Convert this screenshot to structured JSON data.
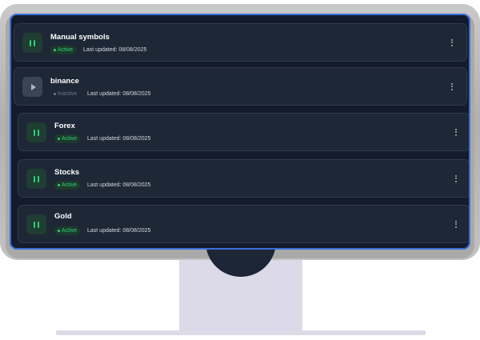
{
  "streams": [
    {
      "name": "Manual symbols",
      "status": "Active",
      "state": "active",
      "updated": "Last updated: 08/08/2025",
      "action_icon": "pause-icon",
      "menu_icon": "more-vertical-icon"
    },
    {
      "name": "binance",
      "status": "Inactive",
      "state": "inactive",
      "updated": "Last updated: 08/08/2025",
      "action_icon": "play-icon",
      "menu_icon": "more-vertical-icon"
    },
    {
      "name": "Forex",
      "status": "Active",
      "state": "active",
      "updated": "Last updated: 08/08/2025",
      "action_icon": "pause-icon",
      "menu_icon": "more-vertical-icon"
    },
    {
      "name": "Stocks",
      "status": "Active",
      "state": "active",
      "updated": "Last updated: 08/08/2025",
      "action_icon": "pause-icon",
      "menu_icon": "more-vertical-icon"
    },
    {
      "name": "Gold",
      "status": "Active",
      "state": "active",
      "updated": "Last updated: 08/08/2025",
      "action_icon": "pause-icon",
      "menu_icon": "more-vertical-icon"
    }
  ],
  "colors": {
    "screen_bg": "#141c2b",
    "card_bg": "#1e2736",
    "accent_border": "#3b6fd6",
    "active_green": "#2fd27a",
    "inactive_gray": "#6f7787"
  }
}
